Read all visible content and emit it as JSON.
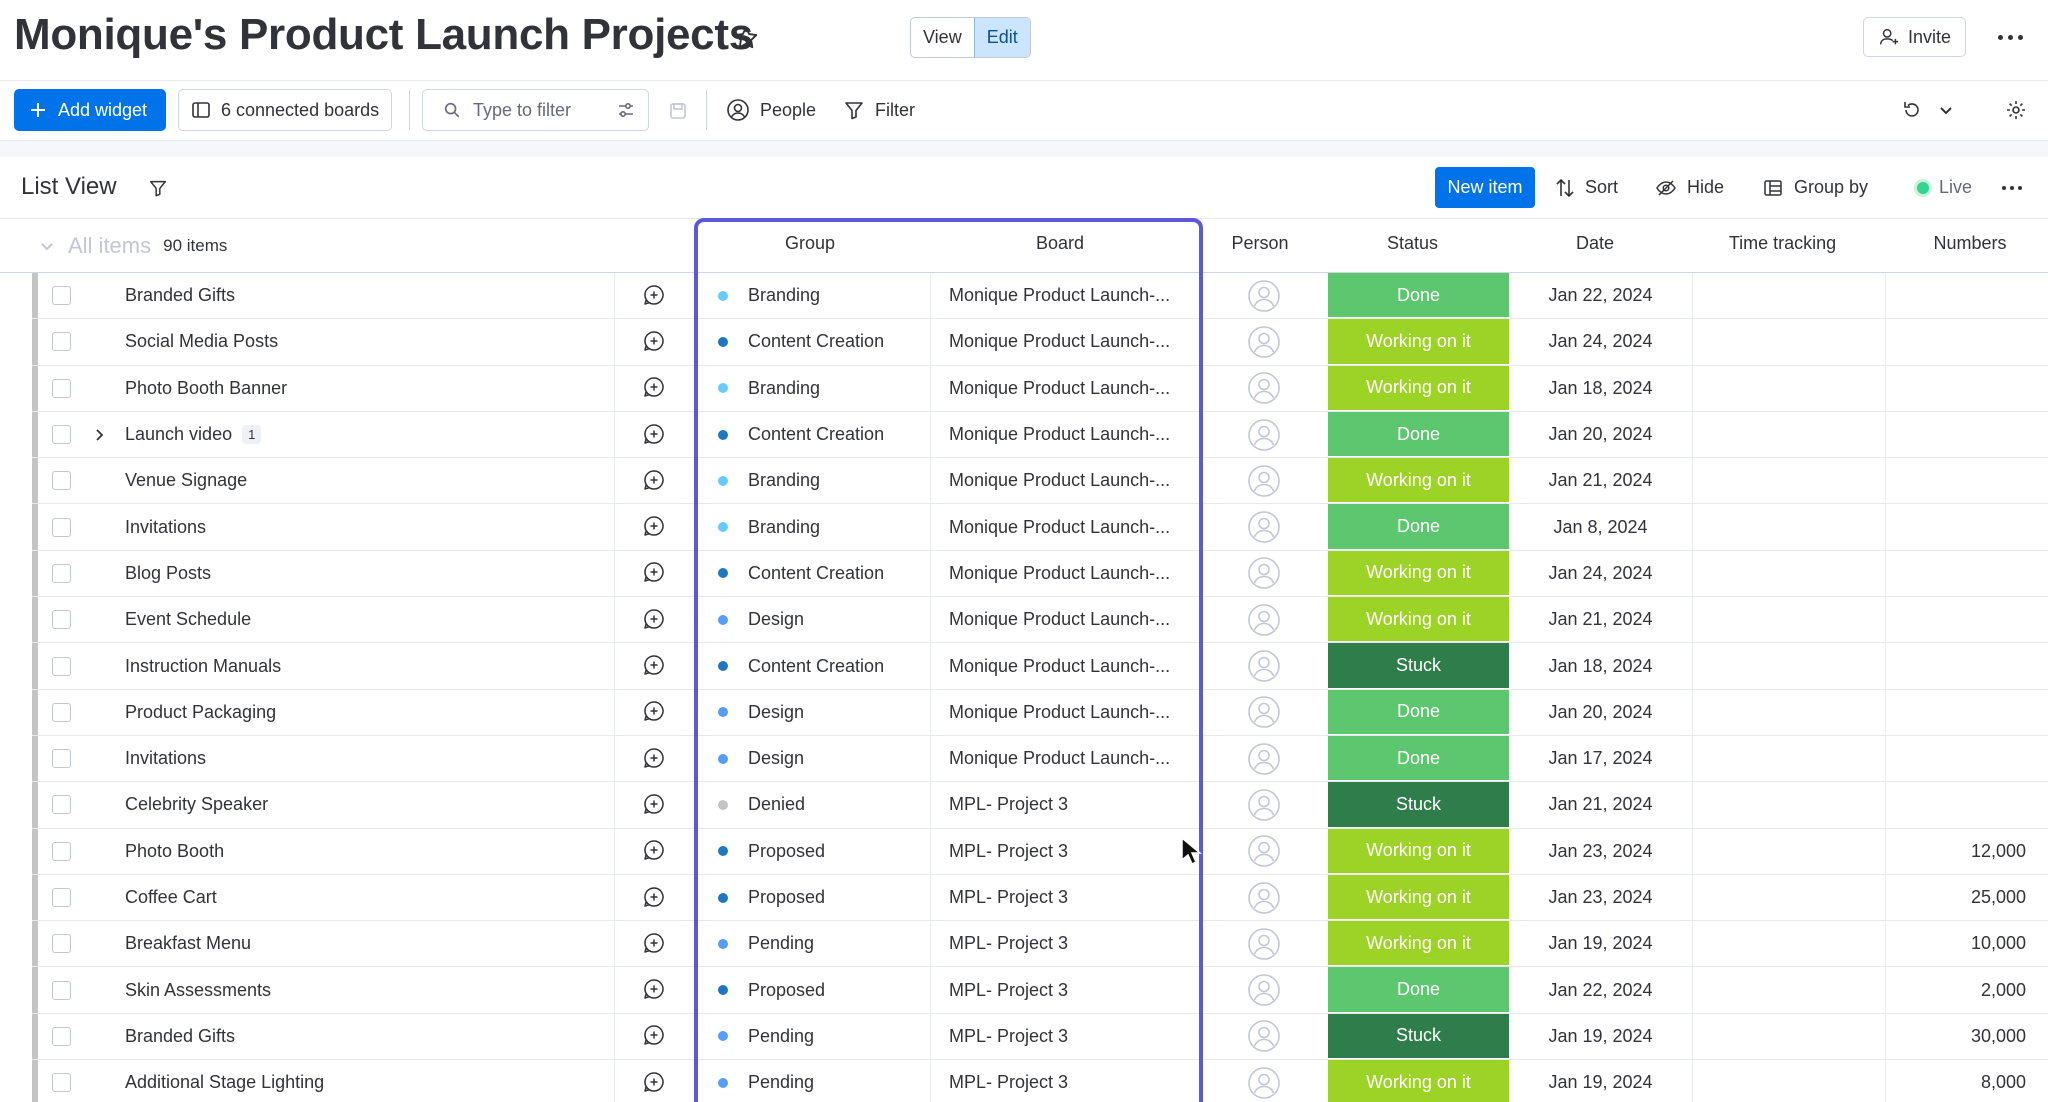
{
  "header": {
    "title": "Monique's Product Launch Projects",
    "view_label": "View",
    "edit_label": "Edit",
    "invite_label": "Invite"
  },
  "toolbar": {
    "add_widget_label": "Add widget",
    "connected_boards_label": "6 connected boards",
    "filter_placeholder": "Type to filter",
    "people_label": "People",
    "filter_label": "Filter"
  },
  "list_view": {
    "title": "List View",
    "new_item_label": "New item",
    "sort_label": "Sort",
    "hide_label": "Hide",
    "group_by_label": "Group by",
    "live_label": "Live"
  },
  "table": {
    "all_items_label": "All items",
    "item_count": "90 items",
    "columns": {
      "group": "Group",
      "board": "Board",
      "person": "Person",
      "status": "Status",
      "date": "Date",
      "time_tracking": "Time tracking",
      "numbers": "Numbers"
    },
    "rows": [
      {
        "name": "Branded Gifts",
        "subitems": "",
        "group": "Branding",
        "board": "Monique Product Launch-...",
        "status": "Done",
        "date": "Jan 22, 2024",
        "numbers": ""
      },
      {
        "name": "Social Media Posts",
        "subitems": "",
        "group": "Content Creation",
        "board": "Monique Product Launch-...",
        "status": "Working on it",
        "date": "Jan 24, 2024",
        "numbers": ""
      },
      {
        "name": "Photo Booth Banner",
        "subitems": "",
        "group": "Branding",
        "board": "Monique Product Launch-...",
        "status": "Working on it",
        "date": "Jan 18, 2024",
        "numbers": ""
      },
      {
        "name": "Launch video",
        "subitems": "1",
        "group": "Content Creation",
        "board": "Monique Product Launch-...",
        "status": "Done",
        "date": "Jan 20, 2024",
        "numbers": ""
      },
      {
        "name": "Venue Signage",
        "subitems": "",
        "group": "Branding",
        "board": "Monique Product Launch-...",
        "status": "Working on it",
        "date": "Jan 21, 2024",
        "numbers": ""
      },
      {
        "name": "Invitations",
        "subitems": "",
        "group": "Branding",
        "board": "Monique Product Launch-...",
        "status": "Done",
        "date": "Jan 8, 2024",
        "numbers": ""
      },
      {
        "name": "Blog Posts",
        "subitems": "",
        "group": "Content Creation",
        "board": "Monique Product Launch-...",
        "status": "Working on it",
        "date": "Jan 24, 2024",
        "numbers": ""
      },
      {
        "name": "Event Schedule",
        "subitems": "",
        "group": "Design",
        "board": "Monique Product Launch-...",
        "status": "Working on it",
        "date": "Jan 21, 2024",
        "numbers": ""
      },
      {
        "name": "Instruction Manuals",
        "subitems": "",
        "group": "Content Creation",
        "board": "Monique Product Launch-...",
        "status": "Stuck",
        "date": "Jan 18, 2024",
        "numbers": ""
      },
      {
        "name": "Product Packaging",
        "subitems": "",
        "group": "Design",
        "board": "Monique Product Launch-...",
        "status": "Done",
        "date": "Jan 20, 2024",
        "numbers": ""
      },
      {
        "name": "Invitations",
        "subitems": "",
        "group": "Design",
        "board": "Monique Product Launch-...",
        "status": "Done",
        "date": "Jan 17, 2024",
        "numbers": ""
      },
      {
        "name": "Celebrity Speaker",
        "subitems": "",
        "group": "Denied",
        "board": "MPL- Project 3",
        "status": "Stuck",
        "date": "Jan 21, 2024",
        "numbers": ""
      },
      {
        "name": "Photo Booth",
        "subitems": "",
        "group": "Proposed",
        "board": "MPL- Project 3",
        "status": "Working on it",
        "date": "Jan 23, 2024",
        "numbers": "12,000"
      },
      {
        "name": "Coffee Cart",
        "subitems": "",
        "group": "Proposed",
        "board": "MPL- Project 3",
        "status": "Working on it",
        "date": "Jan 23, 2024",
        "numbers": "25,000"
      },
      {
        "name": "Breakfast Menu",
        "subitems": "",
        "group": "Pending",
        "board": "MPL- Project 3",
        "status": "Working on it",
        "date": "Jan 19, 2024",
        "numbers": "10,000"
      },
      {
        "name": "Skin Assessments",
        "subitems": "",
        "group": "Proposed",
        "board": "MPL- Project 3",
        "status": "Done",
        "date": "Jan 22, 2024",
        "numbers": "2,000"
      },
      {
        "name": "Branded Gifts",
        "subitems": "",
        "group": "Pending",
        "board": "MPL- Project 3",
        "status": "Stuck",
        "date": "Jan 19, 2024",
        "numbers": "30,000"
      },
      {
        "name": "Additional Stage Lighting",
        "subitems": "",
        "group": "Pending",
        "board": "MPL- Project 3",
        "status": "Working on it",
        "date": "Jan 19, 2024",
        "numbers": "8,000"
      }
    ]
  },
  "colors": {
    "accent": "#0073ea",
    "highlight_border": "#5b59d6",
    "status": {
      "Done": "#5cc76f",
      "Working on it": "#9cd326",
      "Stuck": "#2f7d4b"
    },
    "group": {
      "Branding": "#66ccff",
      "Content Creation": "#1f76c2",
      "Design": "#579bfc",
      "Denied": "#c4c4c4",
      "Proposed": "#1f76c2",
      "Pending": "#579bfc"
    }
  }
}
